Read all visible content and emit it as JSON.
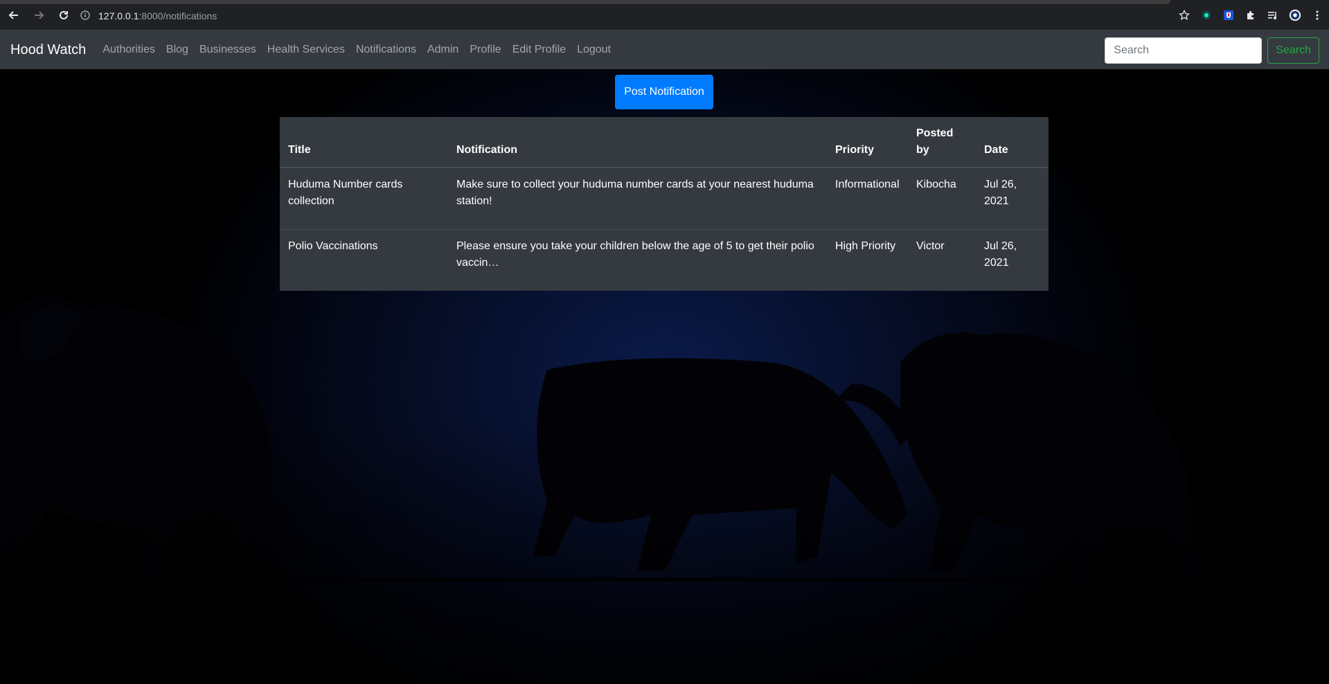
{
  "browser": {
    "url_host": "127.0.0.1",
    "url_path": ":8000/notifications"
  },
  "navbar": {
    "brand": "Hood Watch",
    "links": [
      "Authorities",
      "Blog",
      "Businesses",
      "Health Services",
      "Notifications",
      "Admin",
      "Profile",
      "Edit Profile",
      "Logout"
    ],
    "search_placeholder": "Search",
    "search_button": "Search"
  },
  "post_button": "Post Notification",
  "table": {
    "headers": {
      "title": "Title",
      "notification": "Notification",
      "priority": "Priority",
      "posted_by": "Posted by",
      "date": "Date"
    },
    "rows": [
      {
        "title": "Huduma Number cards collection",
        "notification": "Make sure to collect your huduma number cards at your nearest huduma station!",
        "priority": "Informational",
        "posted_by": "Kibocha",
        "date": "Jul 26, 2021"
      },
      {
        "title": "Polio Vaccinations",
        "notification": "Please ensure you take your children below the age of 5 to get their polio vaccin…",
        "priority": "High Priority",
        "posted_by": "Victor",
        "date": "Jul 26, 2021"
      }
    ]
  },
  "colors": {
    "navbar_bg": "#343a40",
    "primary": "#007bff",
    "success": "#28a745",
    "table_bg": "#343a40"
  }
}
